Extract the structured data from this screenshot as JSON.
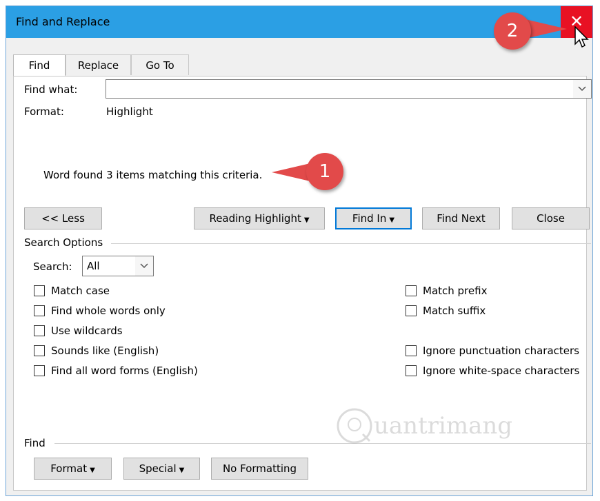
{
  "window": {
    "title": "Find and Replace",
    "close_glyph": "✕"
  },
  "callouts": [
    {
      "number": "1"
    },
    {
      "number": "2"
    }
  ],
  "tabs": [
    {
      "label": "Find"
    },
    {
      "label": "Replace"
    },
    {
      "label": "Go To"
    }
  ],
  "find_what": {
    "label": "Find what:",
    "value": ""
  },
  "format": {
    "label": "Format:",
    "value": "Highlight"
  },
  "status_message": "Word found 3 items matching this criteria.",
  "buttons": {
    "less": "<< Less",
    "reading_highlight": "Reading Highlight",
    "find_in": "Find In",
    "find_next": "Find Next",
    "close": "Close"
  },
  "search_options": {
    "heading": "Search Options",
    "search_label": "Search:",
    "search_value": "All",
    "left_checkboxes": [
      {
        "label": "Match case",
        "checked": false
      },
      {
        "label": "Find whole words only",
        "checked": false
      },
      {
        "label": "Use wildcards",
        "checked": false
      },
      {
        "label": "Sounds like (English)",
        "checked": false
      },
      {
        "label": "Find all word forms (English)",
        "checked": false
      }
    ],
    "right_checkboxes": [
      {
        "label": "Match prefix",
        "checked": false
      },
      {
        "label": "Match suffix",
        "checked": false
      },
      {
        "label": "Ignore punctuation characters",
        "checked": false
      },
      {
        "label": "Ignore white-space characters",
        "checked": false
      }
    ]
  },
  "find_group": {
    "heading": "Find",
    "format_button": "Format",
    "special_button": "Special",
    "no_formatting_button": "No Formatting"
  },
  "watermark": {
    "text": "uantrimang"
  },
  "colors": {
    "titlebar": "#2b9fe4",
    "close_button": "#e81123",
    "callout": "#e24a4a",
    "focus_border": "#0078d7"
  }
}
